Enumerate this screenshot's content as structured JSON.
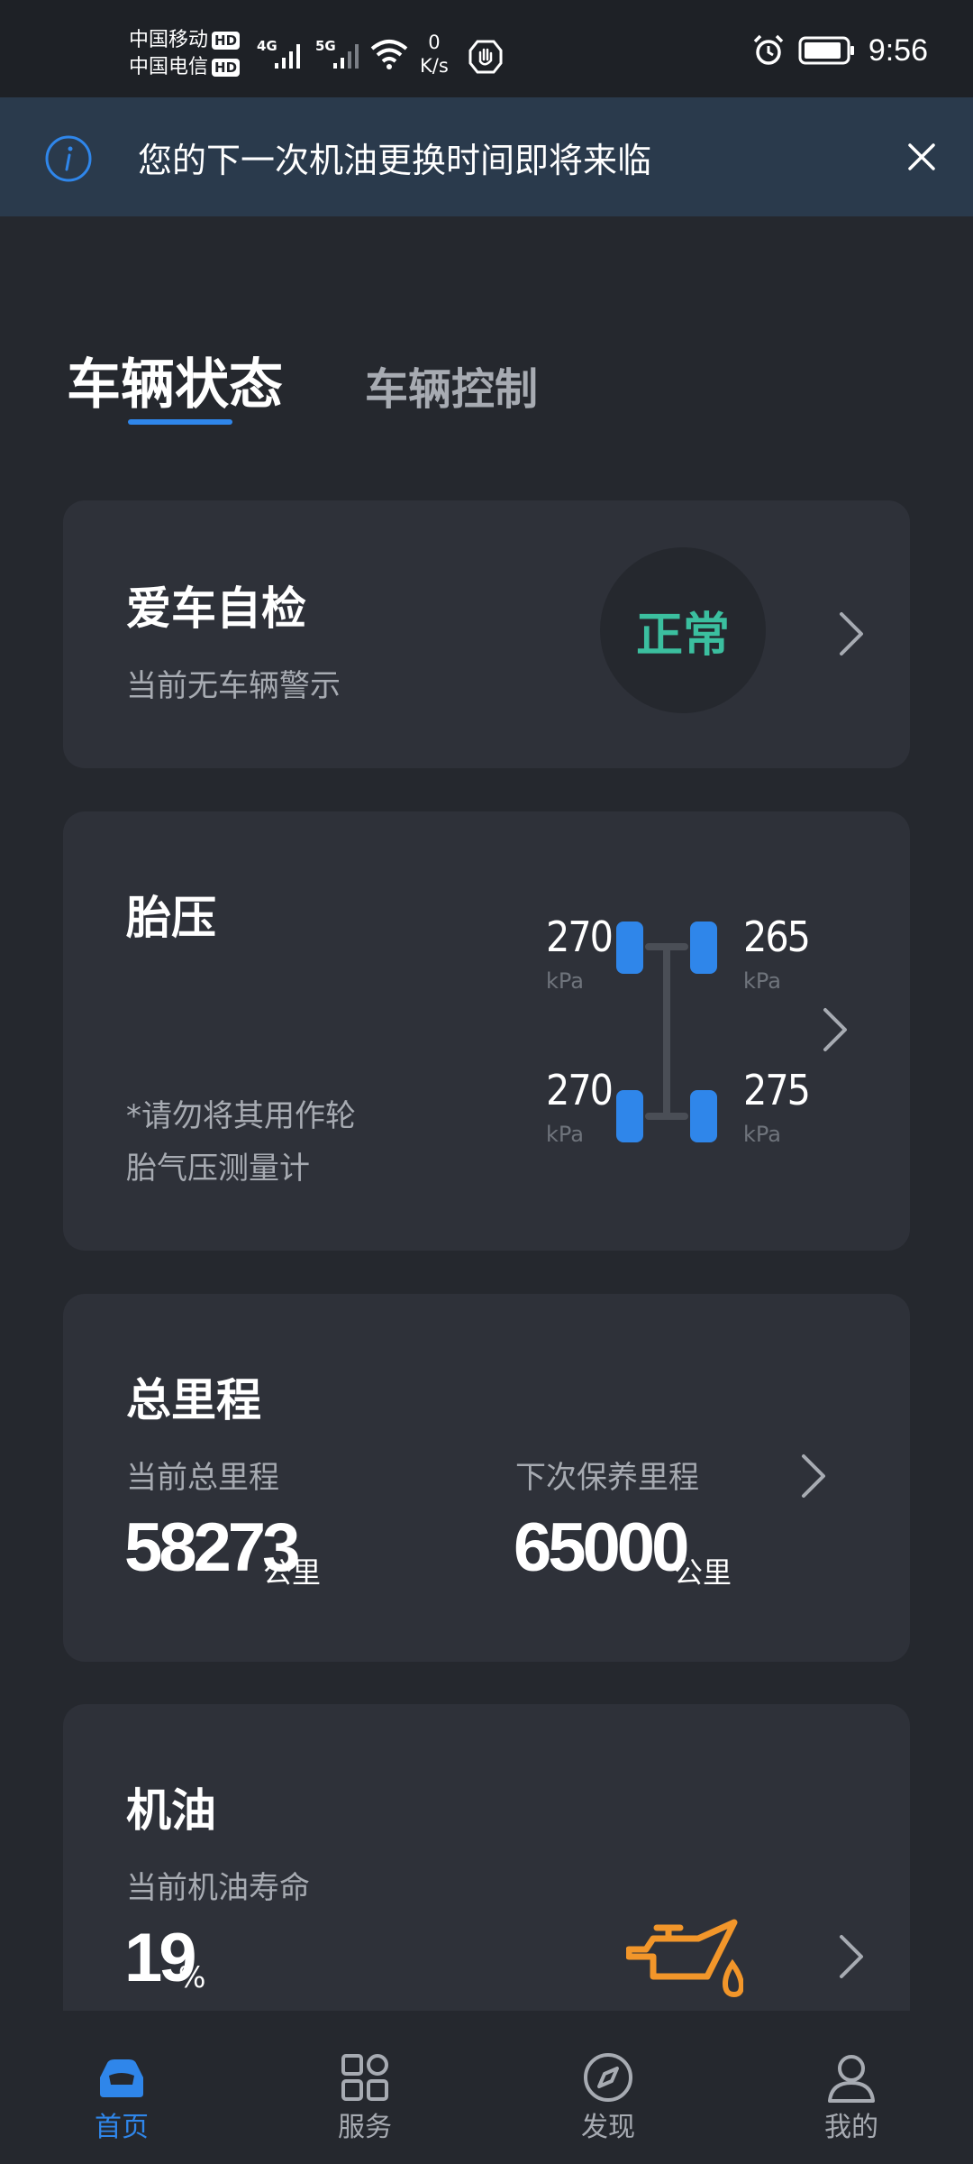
{
  "status_bar": {
    "carrier1": "中国移动",
    "carrier2": "中国电信",
    "hd_badge": "HD",
    "sim1_network": "4G",
    "sim2_network": "5G",
    "speed_value": "0",
    "speed_unit": "K/s",
    "time": "9:56",
    "icons": [
      "signal-icon",
      "wifi-icon",
      "hand-icon",
      "alarm-icon",
      "battery-icon"
    ]
  },
  "banner": {
    "message": "您的下一次机油更换时间即将来临",
    "icons": [
      "info-icon",
      "close-icon"
    ]
  },
  "tabs": {
    "active": "车辆状态",
    "inactive": "车辆控制"
  },
  "self_check": {
    "title": "爱车自检",
    "subtitle": "当前无车辆警示",
    "status": "正常"
  },
  "tire_pressure": {
    "title": "胎压",
    "note_line1": "*请勿将其用作轮",
    "note_line2": "胎气压测量计",
    "front_left": "270",
    "front_right": "265",
    "rear_left": "270",
    "rear_right": "275",
    "unit": "kPa"
  },
  "mileage": {
    "title": "总里程",
    "current_label": "当前总里程",
    "current_value": "58273",
    "next_label": "下次保养里程",
    "next_value": "65000",
    "unit": "公里"
  },
  "oil": {
    "title": "机油",
    "subtitle": "当前机油寿命",
    "value": "19",
    "unit": "%"
  },
  "nav": {
    "home": "首页",
    "service": "服务",
    "discover": "发现",
    "mine": "我的"
  },
  "colors": {
    "background": "#25282e",
    "card": "#2e3139",
    "accent_blue": "#2f86ea",
    "status_green": "#3bbf9f",
    "oil_orange": "#f2962a"
  }
}
